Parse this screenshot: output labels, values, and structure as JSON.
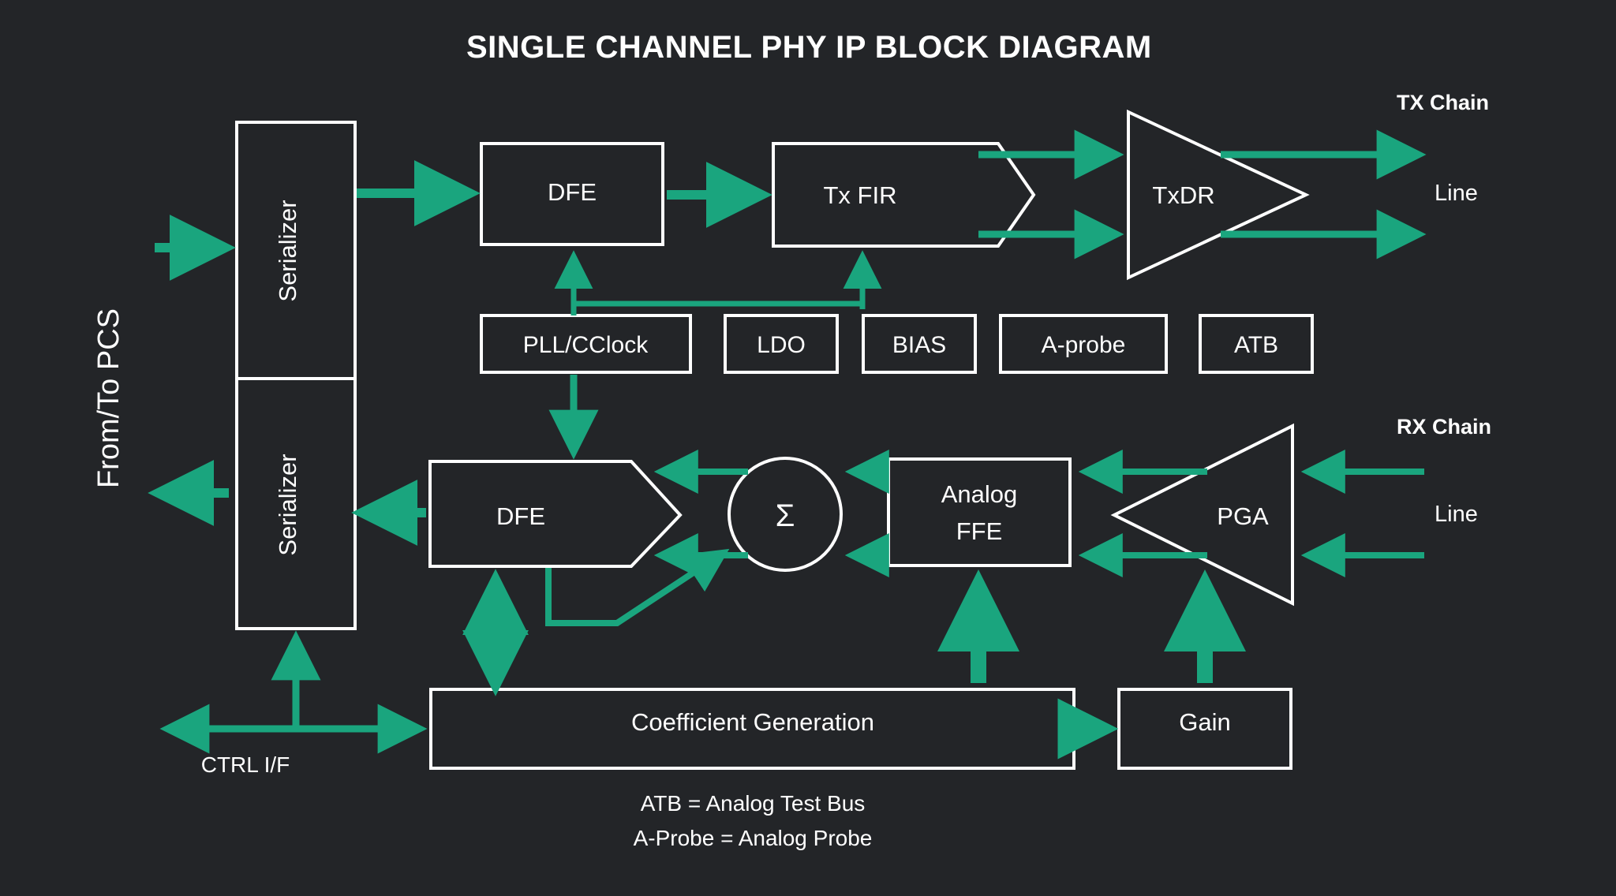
{
  "title": "SINGLE CHANNEL PHY IP BLOCK DIAGRAM",
  "colors": {
    "background": "#232528",
    "accent": "#1aa57e",
    "stroke": "#ffffff",
    "text": "#ffffff"
  },
  "side_label": "From/To PCS",
  "chains": {
    "tx_label": "TX Chain",
    "rx_label": "RX Chain",
    "tx_line": "Line",
    "rx_line": "Line"
  },
  "blocks": {
    "serializer_top": "Serializer",
    "serializer_bottom": "Serializer",
    "tx_dfe": "DFE",
    "tx_fir": "Tx FIR",
    "txdr": "TxDR",
    "pll": "PLL/CClock",
    "ldo": "LDO",
    "bias": "BIAS",
    "aprobe": "A-probe",
    "atb": "ATB",
    "rx_dfe": "DFE",
    "summer": "Σ",
    "analog_ffe_line1": "Analog",
    "analog_ffe_line2": "FFE",
    "pga": "PGA",
    "coeff_gen": "Coefficient Generation",
    "gain": "Gain"
  },
  "labels": {
    "ctrl_if": "CTRL I/F"
  },
  "legend": {
    "line1": "ATB = Analog Test Bus",
    "line2": "A-Probe = Analog Probe"
  }
}
